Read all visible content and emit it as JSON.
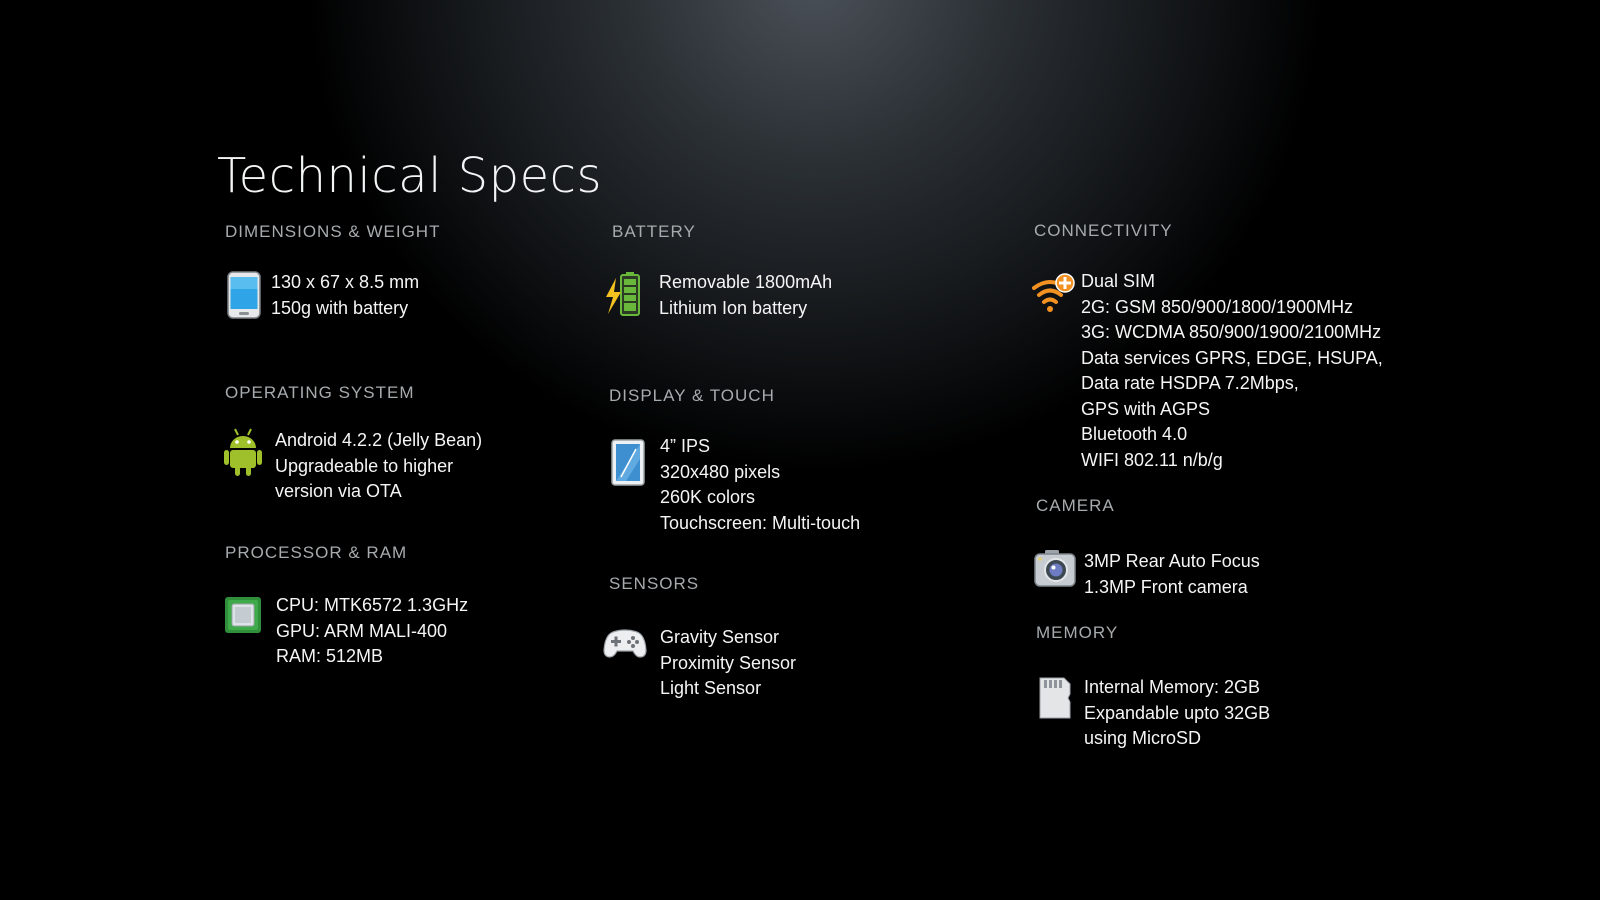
{
  "page": {
    "title": "Technical Specs"
  },
  "sections": {
    "dimensions": {
      "heading": "DIMENSIONS & WEIGHT",
      "icon": "phone-icon",
      "lines": [
        "130 x 67 x 8.5 mm",
        "150g with battery"
      ]
    },
    "os": {
      "heading": "OPERATING SYSTEM",
      "icon": "android-icon",
      "lines": [
        "Android 4.2.2 (Jelly Bean)",
        "Upgradeable to higher",
        "version via OTA"
      ]
    },
    "processor": {
      "heading": "PROCESSOR & RAM",
      "icon": "chip-icon",
      "lines": [
        "CPU: MTK6572 1.3GHz",
        "GPU: ARM MALI-400",
        "RAM: 512MB"
      ]
    },
    "battery": {
      "heading": "BATTERY",
      "icon": "battery-charging-icon",
      "lines": [
        "Removable 1800mAh",
        "Lithium Ion battery"
      ]
    },
    "display": {
      "heading": "DISPLAY & TOUCH",
      "icon": "tablet-display-icon",
      "lines": [
        "4” IPS",
        "320x480 pixels",
        "260K colors",
        "Touchscreen: Multi-touch"
      ]
    },
    "sensors": {
      "heading": "SENSORS",
      "icon": "gamepad-icon",
      "lines": [
        "Gravity Sensor",
        "Proximity Sensor",
        "Light Sensor"
      ]
    },
    "connectivity": {
      "heading": "CONNECTIVITY",
      "icon": "wifi-plus-icon",
      "lines": [
        "Dual SIM",
        "2G: GSM 850/900/1800/1900MHz",
        "3G: WCDMA 850/900/1900/2100MHz",
        "Data services GPRS, EDGE, HSUPA,",
        "Data rate HSDPA 7.2Mbps,",
        "GPS with AGPS",
        "Bluetooth 4.0",
        "WIFI 802.11 n/b/g"
      ]
    },
    "camera": {
      "heading": "CAMERA",
      "icon": "camera-icon",
      "lines": [
        "3MP Rear Auto Focus",
        "1.3MP Front camera"
      ]
    },
    "memory": {
      "heading": "MEMORY",
      "icon": "sd-card-icon",
      "lines": [
        "Internal Memory: 2GB",
        "Expandable upto 32GB",
        "using MicroSD"
      ]
    }
  },
  "colors": {
    "heading": "#a7abae",
    "text": "#f5f5f5",
    "android_green": "#9fc02a",
    "battery_green": "#6ab83b",
    "bolt_yellow": "#f3c21f",
    "wifi_orange": "#f39223"
  }
}
